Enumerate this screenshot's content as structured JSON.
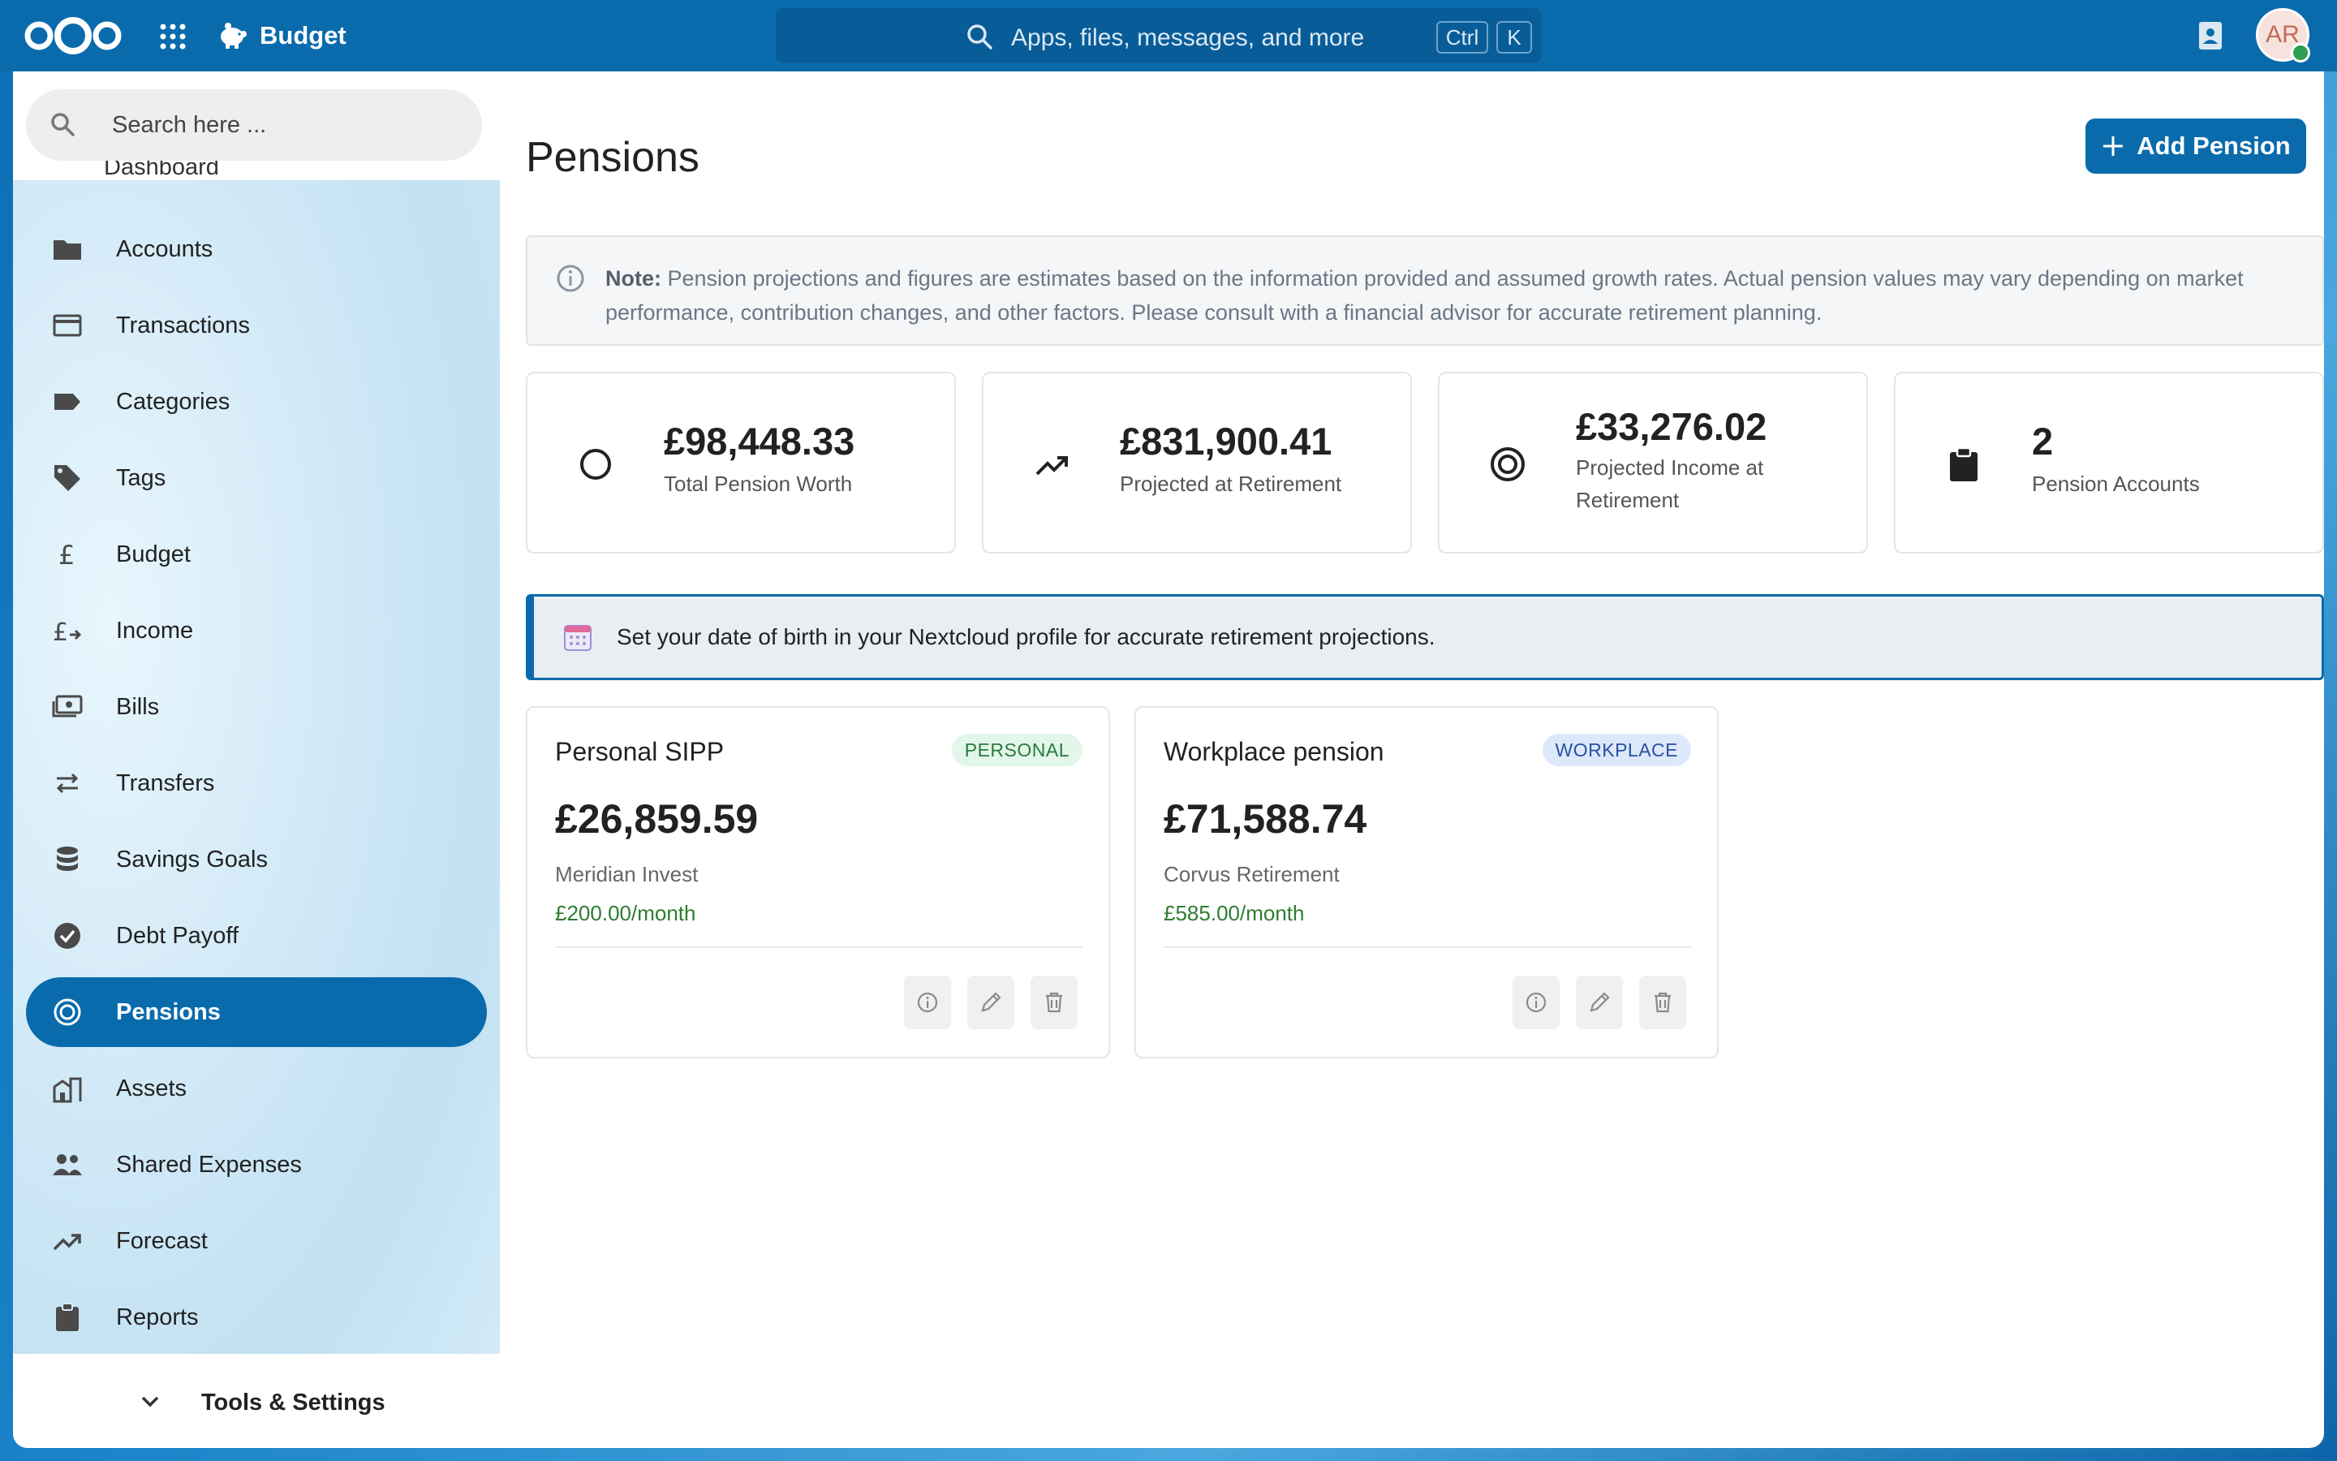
{
  "header": {
    "app_name": "Budget",
    "search_placeholder": "Apps, files, messages, and more",
    "shortcut_ctrl": "Ctrl",
    "shortcut_k": "K",
    "avatar_initials": "AR"
  },
  "sidebar": {
    "search_placeholder": "Search here ...",
    "partial_item": "Dashboard",
    "items": [
      {
        "label": "Accounts",
        "icon": "folder-icon"
      },
      {
        "label": "Transactions",
        "icon": "credit-card-icon"
      },
      {
        "label": "Categories",
        "icon": "label-icon"
      },
      {
        "label": "Tags",
        "icon": "tag-icon"
      },
      {
        "label": "Budget",
        "icon": "pound-icon"
      },
      {
        "label": "Income",
        "icon": "pound-plus-icon"
      },
      {
        "label": "Bills",
        "icon": "cash-icon"
      },
      {
        "label": "Transfers",
        "icon": "swap-icon"
      },
      {
        "label": "Savings Goals",
        "icon": "database-icon"
      },
      {
        "label": "Debt Payoff",
        "icon": "check-circle-icon"
      },
      {
        "label": "Pensions",
        "icon": "target-icon",
        "active": true
      },
      {
        "label": "Assets",
        "icon": "building-icon"
      },
      {
        "label": "Shared Expenses",
        "icon": "people-icon"
      },
      {
        "label": "Forecast",
        "icon": "trending-up-icon"
      },
      {
        "label": "Reports",
        "icon": "clipboard-icon"
      }
    ],
    "footer_label": "Tools & Settings"
  },
  "main": {
    "title": "Pensions",
    "add_button": "Add Pension",
    "note": {
      "label": "Note:",
      "text": "Pension projections and figures are estimates based on the information provided and assumed growth rates. Actual pension values may vary depending on market performance, contribution changes, and other factors. Please consult with a financial advisor for accurate retirement planning."
    },
    "stats": [
      {
        "value": "£98,448.33",
        "label": "Total Pension Worth",
        "icon": "circle-icon"
      },
      {
        "value": "£831,900.41",
        "label": "Projected at Retirement",
        "icon": "trending-up-icon"
      },
      {
        "value": "£33,276.02",
        "label": "Projected Income at Retirement",
        "icon": "target-icon"
      },
      {
        "value": "2",
        "label": "Pension Accounts",
        "icon": "clipboard-icon"
      }
    ],
    "banner": "Set your date of birth in your Nextcloud profile for accurate retirement projections.",
    "pensions": [
      {
        "name": "Personal SIPP",
        "type": "PERSONAL",
        "value": "£26,859.59",
        "provider": "Meridian Invest",
        "contribution": "£200.00/month"
      },
      {
        "name": "Workplace pension",
        "type": "WORKPLACE",
        "value": "£71,588.74",
        "provider": "Corvus Retirement",
        "contribution": "£585.00/month"
      }
    ]
  },
  "colors": {
    "primary": "#0a6bac",
    "contribution_green": "#2e7d32",
    "personal_badge_bg": "#e2f6e9",
    "workplace_badge_bg": "#dde8fb"
  }
}
